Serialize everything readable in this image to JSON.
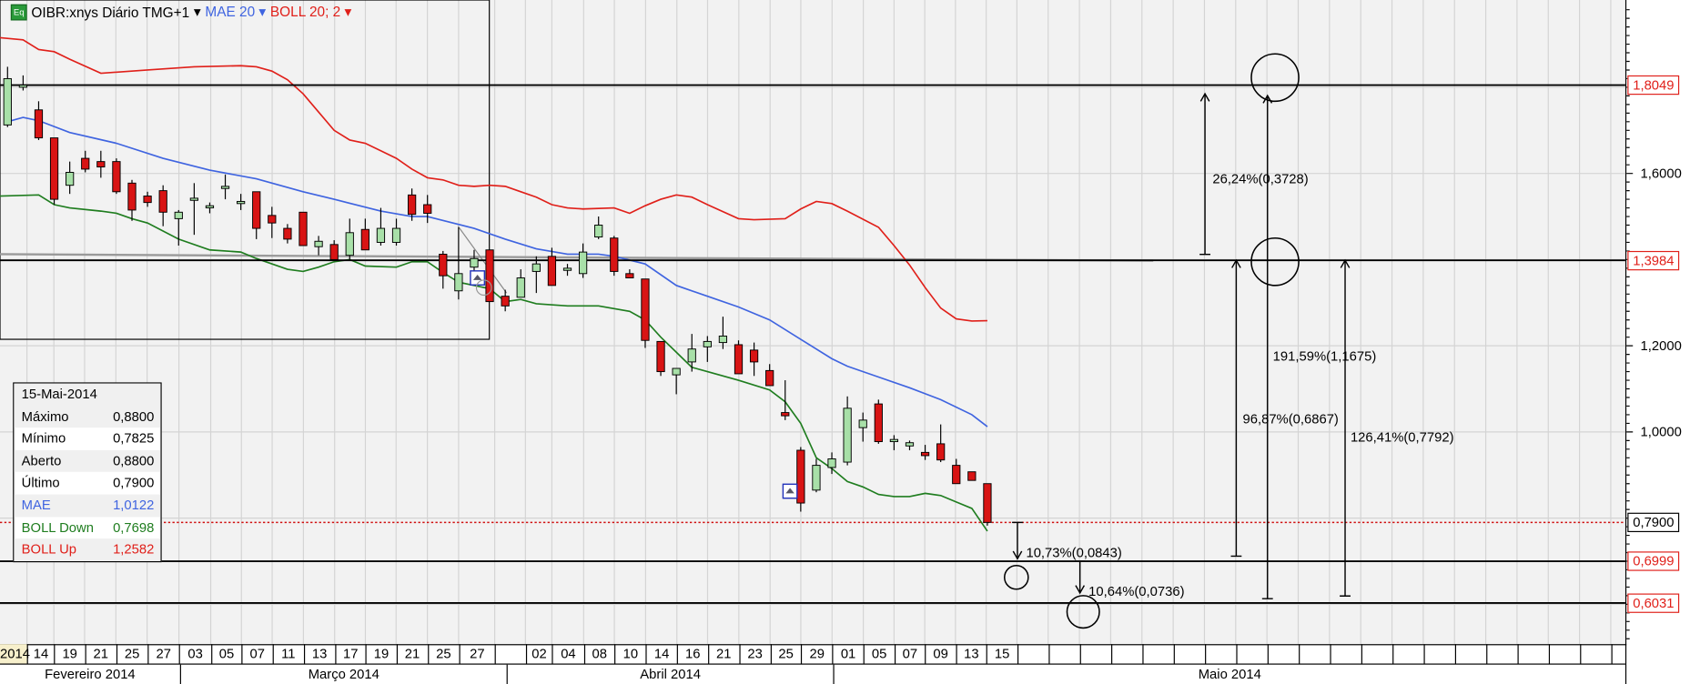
{
  "header": {
    "symbol": "OIBR:xnys Diário TMG+1",
    "symbol_caret": "▾",
    "mae": "MAE 20 ▾",
    "boll": "BOLL 20; 2 ▾",
    "eq_icon": "Eq"
  },
  "info_box": {
    "date": "15-Mai-2014",
    "rows": [
      {
        "label": "Máximo",
        "value": "0,8800",
        "color": "#000000"
      },
      {
        "label": "Mínimo",
        "value": "0,7825",
        "color": "#000000"
      },
      {
        "label": "Aberto",
        "value": "0,8800",
        "color": "#000000"
      },
      {
        "label": "Último",
        "value": "0,7900",
        "color": "#000000"
      },
      {
        "label": "MAE",
        "value": "1,0122",
        "color": "#3f64e0"
      },
      {
        "label": "BOLL Down",
        "value": "0,7698",
        "color": "#1f7d1f"
      },
      {
        "label": "BOLL Up",
        "value": "1,2582",
        "color": "#e0201a"
      }
    ]
  },
  "chart_data": {
    "type": "candlestick",
    "title": "OIBR:xnys Diário TMG+1",
    "ylim": [
      0.51,
      2.0
    ],
    "y_ticks": [
      {
        "value": 1.6,
        "label": "1,6000"
      },
      {
        "value": 1.2,
        "label": "1,2000"
      },
      {
        "value": 1.0,
        "label": "1,0000"
      }
    ],
    "grid": true,
    "candles": [
      [
        1.7125,
        1.8475,
        1.7075,
        1.82
      ],
      [
        1.8025,
        1.8275,
        1.7925,
        1.805
      ],
      [
        1.7475,
        1.7675,
        1.6775,
        1.6825
      ],
      [
        1.6825,
        1.6825,
        1.5275,
        1.54
      ],
      [
        1.5725,
        1.6275,
        1.5525,
        1.6025
      ],
      [
        1.635,
        1.6525,
        1.6025,
        1.61
      ],
      [
        1.6275,
        1.6525,
        1.59,
        1.615
      ],
      [
        1.6275,
        1.635,
        1.5525,
        1.5575
      ],
      [
        1.5775,
        1.585,
        1.49,
        1.515
      ],
      [
        1.5475,
        1.5575,
        1.5225,
        1.5325
      ],
      [
        1.56,
        1.5725,
        1.4775,
        1.51
      ],
      [
        1.495,
        1.515,
        1.4325,
        1.51
      ],
      [
        1.5375,
        1.5775,
        1.4575,
        1.5425
      ],
      [
        1.52,
        1.5325,
        1.5075,
        1.525
      ],
      [
        1.565,
        1.5975,
        1.54,
        1.57
      ],
      [
        1.53,
        1.5525,
        1.515,
        1.535
      ],
      [
        1.5575,
        1.5575,
        1.4475,
        1.4725
      ],
      [
        1.5025,
        1.5225,
        1.45,
        1.485
      ],
      [
        1.4725,
        1.4825,
        1.4375,
        1.4475
      ],
      [
        1.51,
        1.51,
        1.4325,
        1.4325
      ],
      [
        1.43,
        1.455,
        1.41,
        1.4425
      ],
      [
        1.435,
        1.445,
        1.4,
        1.4
      ],
      [
        1.41,
        1.495,
        1.4,
        1.4625
      ],
      [
        1.47,
        1.495,
        1.4225,
        1.4225
      ],
      [
        1.44,
        1.52,
        1.4325,
        1.4725
      ],
      [
        1.44,
        1.495,
        1.4325,
        1.4725
      ],
      [
        1.55,
        1.565,
        1.49,
        1.505
      ],
      [
        1.5275,
        1.55,
        1.485,
        1.5075
      ],
      [
        1.4125,
        1.42,
        1.3325,
        1.3625
      ],
      [
        1.3275,
        1.475,
        1.3075,
        1.3675
      ],
      [
        1.3825,
        1.4225,
        1.3575,
        1.4025
      ],
      [
        1.4225,
        1.4225,
        1.3025,
        1.3025
      ],
      [
        1.315,
        1.33,
        1.28,
        1.2925
      ],
      [
        1.3125,
        1.3775,
        1.3125,
        1.3575
      ],
      [
        1.3725,
        1.4075,
        1.3225,
        1.39
      ],
      [
        1.4075,
        1.4275,
        1.34,
        1.34
      ],
      [
        1.375,
        1.39,
        1.3625,
        1.38
      ],
      [
        1.3675,
        1.4375,
        1.3575,
        1.4175
      ],
      [
        1.4525,
        1.5,
        1.4475,
        1.48
      ],
      [
        1.45,
        1.455,
        1.3625,
        1.3725
      ],
      [
        1.3675,
        1.3775,
        1.3575,
        1.3575
      ],
      [
        1.355,
        1.355,
        1.195,
        1.2125
      ],
      [
        1.21,
        1.21,
        1.13,
        1.14
      ],
      [
        1.1325,
        1.1475,
        1.0875,
        1.1475
      ],
      [
        1.1625,
        1.2275,
        1.14,
        1.1925
      ],
      [
        1.1975,
        1.2225,
        1.1625,
        1.21
      ],
      [
        1.2075,
        1.2675,
        1.1925,
        1.2225
      ],
      [
        1.2025,
        1.2125,
        1.135,
        1.135
      ],
      [
        1.19,
        1.2075,
        1.13,
        1.1625
      ],
      [
        1.1425,
        1.1575,
        1.1075,
        1.1075
      ],
      [
        1.045,
        1.12,
        1.0275,
        1.0375
      ],
      [
        0.9575,
        0.965,
        0.815,
        0.835
      ],
      [
        0.865,
        0.9375,
        0.86,
        0.9225
      ],
      [
        0.9175,
        0.9525,
        0.9025,
        0.9375
      ],
      [
        0.93,
        1.0825,
        0.9225,
        1.055
      ],
      [
        1.01,
        1.045,
        0.9775,
        1.0275
      ],
      [
        1.065,
        1.075,
        0.9725,
        0.9775
      ],
      [
        0.9775,
        0.9925,
        0.9575,
        0.9825
      ],
      [
        0.9675,
        0.98,
        0.9575,
        0.975
      ],
      [
        0.9525,
        0.97,
        0.935,
        0.945
      ],
      [
        0.9725,
        1.0175,
        0.93,
        0.935
      ],
      [
        0.9225,
        0.9375,
        0.88,
        0.88
      ],
      [
        0.9075,
        0.9075,
        0.8875,
        0.8875
      ],
      [
        0.88,
        0.88,
        0.7825,
        0.79
      ]
    ],
    "candle_fields": [
      "open",
      "high",
      "low",
      "close"
    ],
    "series": [
      {
        "name": "MAE 20",
        "color": "#3f64e0",
        "points": [
          [
            0,
            1.72
          ],
          [
            1,
            1.73
          ],
          [
            2,
            1.7225
          ],
          [
            4,
            1.695
          ],
          [
            7,
            1.67
          ],
          [
            10,
            1.635
          ],
          [
            13,
            1.6075
          ],
          [
            16,
            1.5875
          ],
          [
            19,
            1.5575
          ],
          [
            21,
            1.54
          ],
          [
            24,
            1.5125
          ],
          [
            26,
            1.5
          ],
          [
            27,
            1.5
          ],
          [
            30,
            1.4725
          ],
          [
            32,
            1.4475
          ],
          [
            34,
            1.425
          ],
          [
            36,
            1.4125
          ],
          [
            38,
            1.4125
          ],
          [
            39,
            1.4075
          ],
          [
            41,
            1.39
          ],
          [
            43,
            1.34
          ],
          [
            45,
            1.315
          ],
          [
            47,
            1.29
          ],
          [
            49,
            1.26
          ],
          [
            51,
            1.215
          ],
          [
            53,
            1.17
          ],
          [
            54,
            1.1525
          ],
          [
            56,
            1.1275
          ],
          [
            58,
            1.1025
          ],
          [
            60,
            1.075
          ],
          [
            62,
            1.04
          ],
          [
            63,
            1.0122
          ]
        ]
      },
      {
        "name": "BOLL Up",
        "color": "#e0201a",
        "points": [
          [
            -0.5,
            1.915
          ],
          [
            1,
            1.91
          ],
          [
            2,
            1.8875
          ],
          [
            3,
            1.8825
          ],
          [
            4,
            1.865
          ],
          [
            6,
            1.8325
          ],
          [
            9,
            1.84
          ],
          [
            12,
            1.8475
          ],
          [
            15,
            1.85
          ],
          [
            16,
            1.8475
          ],
          [
            17,
            1.8375
          ],
          [
            18,
            1.8175
          ],
          [
            19,
            1.785
          ],
          [
            20,
            1.7425
          ],
          [
            21,
            1.7
          ],
          [
            22,
            1.6775
          ],
          [
            23,
            1.67
          ],
          [
            24,
            1.6525
          ],
          [
            25,
            1.635
          ],
          [
            26,
            1.61
          ],
          [
            27,
            1.59
          ],
          [
            28,
            1.585
          ],
          [
            29,
            1.5725
          ],
          [
            30,
            1.57
          ],
          [
            31,
            1.5725
          ],
          [
            32,
            1.57
          ],
          [
            33,
            1.5575
          ],
          [
            34,
            1.545
          ],
          [
            35,
            1.5275
          ],
          [
            36,
            1.52
          ],
          [
            37,
            1.5175
          ],
          [
            39,
            1.52
          ],
          [
            40,
            1.5075
          ],
          [
            41,
            1.525
          ],
          [
            42,
            1.54
          ],
          [
            43,
            1.55
          ],
          [
            44,
            1.545
          ],
          [
            45,
            1.5275
          ],
          [
            47,
            1.495
          ],
          [
            48,
            1.4925
          ],
          [
            50,
            1.495
          ],
          [
            51,
            1.5175
          ],
          [
            52,
            1.535
          ],
          [
            53,
            1.53
          ],
          [
            54,
            1.5125
          ],
          [
            56,
            1.475
          ],
          [
            57,
            1.4325
          ],
          [
            58,
            1.3875
          ],
          [
            59,
            1.335
          ],
          [
            60,
            1.2875
          ],
          [
            61,
            1.2625
          ],
          [
            62,
            1.2575
          ],
          [
            63,
            1.2582
          ]
        ]
      },
      {
        "name": "BOLL Down",
        "color": "#1f7d1f",
        "points": [
          [
            -0.5,
            1.5475
          ],
          [
            2,
            1.55
          ],
          [
            3,
            1.5275
          ],
          [
            4,
            1.52
          ],
          [
            6,
            1.5125
          ],
          [
            7,
            1.5075
          ],
          [
            8,
            1.495
          ],
          [
            9,
            1.485
          ],
          [
            11,
            1.4475
          ],
          [
            13,
            1.4225
          ],
          [
            15,
            1.4175
          ],
          [
            16,
            1.4025
          ],
          [
            18,
            1.3775
          ],
          [
            19,
            1.3725
          ],
          [
            20,
            1.3825
          ],
          [
            21,
            1.395
          ],
          [
            22,
            1.4
          ],
          [
            23,
            1.385
          ],
          [
            25,
            1.3825
          ],
          [
            26,
            1.395
          ],
          [
            27,
            1.395
          ],
          [
            28,
            1.37
          ],
          [
            29,
            1.3475
          ],
          [
            30,
            1.34
          ],
          [
            31,
            1.3325
          ],
          [
            32,
            1.3025
          ],
          [
            33,
            1.3075
          ],
          [
            34,
            1.2975
          ],
          [
            36,
            1.2925
          ],
          [
            38,
            1.2925
          ],
          [
            40,
            1.28
          ],
          [
            41,
            1.26
          ],
          [
            42,
            1.22
          ],
          [
            43,
            1.185
          ],
          [
            44,
            1.15
          ],
          [
            45,
            1.14
          ],
          [
            47,
            1.12
          ],
          [
            49,
            1.0975
          ],
          [
            50,
            1.07
          ],
          [
            51,
            1.02
          ],
          [
            52,
            0.94
          ],
          [
            53,
            0.915
          ],
          [
            54,
            0.885
          ],
          [
            55,
            0.8725
          ],
          [
            56,
            0.855
          ],
          [
            57,
            0.85
          ],
          [
            58,
            0.85
          ],
          [
            59,
            0.8575
          ],
          [
            60,
            0.8525
          ],
          [
            61,
            0.8375
          ],
          [
            62,
            0.8225
          ],
          [
            63,
            0.7698
          ]
        ]
      }
    ],
    "levels": [
      {
        "value": 1.8049,
        "label": "1,8049"
      },
      {
        "value": 1.3984,
        "label": "1,3984"
      },
      {
        "value": 0.6999,
        "label": "0,6999"
      },
      {
        "value": 0.6031,
        "label": "0,6031"
      }
    ],
    "last_price": {
      "value": 0.79,
      "label": "0,7900"
    },
    "measurements": [
      {
        "label": "26,24%(0,3728)",
        "from": 1.4121,
        "to": 1.7849
      },
      {
        "label": "96,87%(0,6867)",
        "from": 0.7117,
        "to": 1.3984
      },
      {
        "label": "191,59%(1,1675)",
        "from": 0.6131,
        "to": 1.7806
      },
      {
        "label": "126,41%(0,7792)",
        "from": 0.6192,
        "to": 1.3984
      },
      {
        "label": "10,73%(0,0843)",
        "from": 0.79,
        "to": 0.7057
      },
      {
        "label": "10,64%(0,0736)",
        "from": 0.6999,
        "to": 0.6263
      }
    ],
    "x_dates": [
      "2014",
      "14",
      "19",
      "21",
      "25",
      "27",
      "03",
      "05",
      "07",
      "11",
      "13",
      "17",
      "19",
      "21",
      "25",
      "27",
      "",
      "02",
      "04",
      "08",
      "10",
      "14",
      "16",
      "21",
      "23",
      "25",
      "29",
      "01",
      "05",
      "07",
      "09",
      "13",
      "15"
    ],
    "x_months": [
      "Fevereiro 2014",
      "Março 2014",
      "Abril 2014",
      "Maio 2014"
    ]
  }
}
